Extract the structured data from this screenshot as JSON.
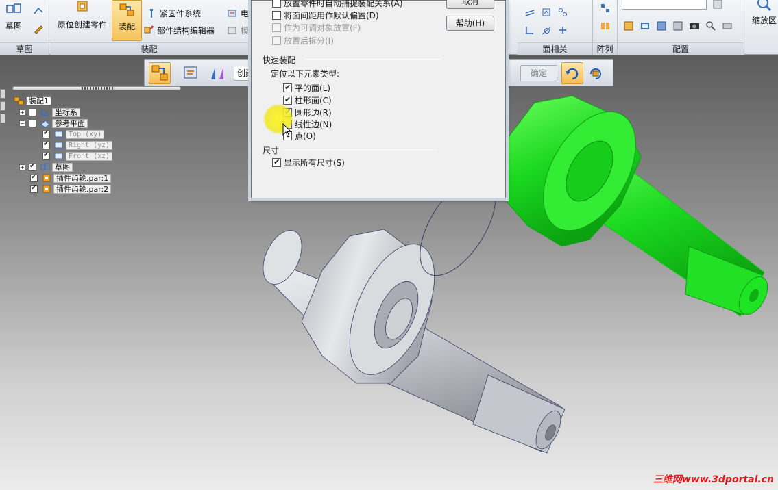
{
  "ribbon": {
    "groups": {
      "sketch": "草图",
      "assembly": "装配",
      "face_related": "面相关",
      "pattern": "阵列",
      "configure": "配置"
    },
    "buttons": {
      "sketch": "草图",
      "create_in_place": "原位创建零件",
      "assemble": "装配",
      "fastener_system": "紧固件系统",
      "structure_editor": "部件结构编辑器",
      "electrical": "电",
      "mold": "模",
      "zoom_area": "缩放区"
    }
  },
  "command_bar": {
    "create_label": "创建",
    "confirm": "确定"
  },
  "tree": {
    "root": "装配1",
    "items": [
      {
        "label": "坐标系"
      },
      {
        "label": "参考平面"
      },
      {
        "label": "Top (xy)"
      },
      {
        "label": "Right (yz)"
      },
      {
        "label": "Front (xz)"
      },
      {
        "label": "草图"
      },
      {
        "label": "插件齿轮.par:1"
      },
      {
        "label": "插件齿轮.par:2"
      }
    ]
  },
  "dialog": {
    "options": [
      {
        "label": "放置零件时自动捕捉装配关系(A)",
        "checked": false,
        "enabled": true
      },
      {
        "label": "将面间距用作默认偏置(D)",
        "checked": false,
        "enabled": true
      },
      {
        "label": "作为可调对象放置(F)",
        "checked": false,
        "enabled": false
      },
      {
        "label": "放置后拆分(I)",
        "checked": false,
        "enabled": false
      }
    ],
    "cancel": "取消",
    "help": "帮助(H)",
    "quick_assemble": {
      "title": "快速装配",
      "subtitle": "定位以下元素类型:",
      "items": [
        {
          "label": "平的面(L)",
          "checked": true
        },
        {
          "label": "柱形面(C)",
          "checked": true
        },
        {
          "label": "圆形边(R)",
          "checked": true
        },
        {
          "label": "线性边(N)",
          "checked": false
        },
        {
          "label": "点(O)",
          "checked": false
        }
      ]
    },
    "dimension": {
      "title": "尺寸",
      "show_all": "显示所有尺寸(S)",
      "show_all_checked": true
    }
  },
  "watermark": "三维网www.3dportal.cn",
  "colors": {
    "selected_part": "#19e01f",
    "part_gray": "#c6c9cf",
    "accent": "#f5bd55"
  }
}
